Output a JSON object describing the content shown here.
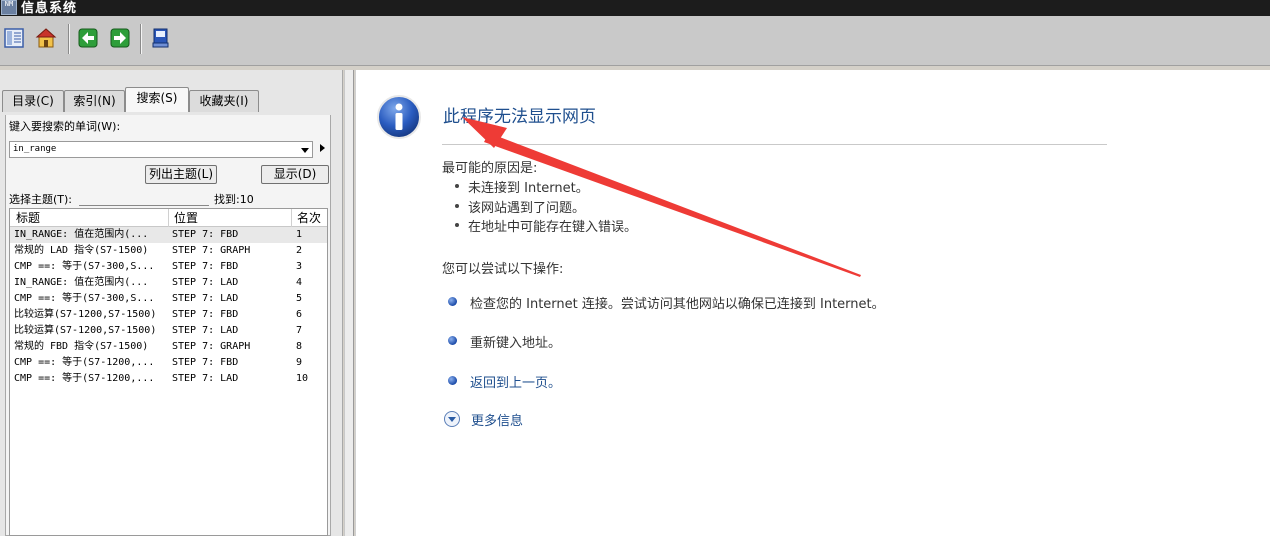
{
  "window": {
    "title": "信息系统",
    "app_icon_text": "NM"
  },
  "toolbar": {
    "buttons": [
      {
        "name": "hide-pane-button",
        "icon": "toc-pane-icon"
      },
      {
        "name": "home-button",
        "icon": "home-icon"
      },
      {
        "name": "back-button",
        "icon": "back-arrow-icon"
      },
      {
        "name": "forward-button",
        "icon": "forward-arrow-icon"
      },
      {
        "name": "print-button",
        "icon": "print-icon"
      }
    ],
    "colors": {
      "green": "#2e9e3a",
      "blue": "#2a56b8"
    }
  },
  "nav": {
    "tabs": [
      {
        "label": "目录(C)",
        "active": false
      },
      {
        "label": "索引(N)",
        "active": false
      },
      {
        "label": "搜索(S)",
        "active": true
      },
      {
        "label": "收藏夹(I)",
        "active": false
      }
    ]
  },
  "search": {
    "keyword_label": "键入要搜索的单词(W):",
    "keyword_value": "in_range",
    "list_topics_button": "列出主题(L)",
    "display_button": "显示(D)",
    "select_topic_label": "选择主题(T):",
    "found_label": "找到:10",
    "columns": [
      "标题",
      "位置",
      "名次"
    ],
    "rows": [
      {
        "title": "IN_RANGE: 值在范围内(...",
        "location": "STEP 7: FBD",
        "rank": "1"
      },
      {
        "title": "常规的 LAD 指令(S7-1500)",
        "location": "STEP 7: GRAPH",
        "rank": "2"
      },
      {
        "title": "CMP ==: 等于(S7-300,S...",
        "location": "STEP 7: FBD",
        "rank": "3"
      },
      {
        "title": "IN_RANGE: 值在范围内(...",
        "location": "STEP 7: LAD",
        "rank": "4"
      },
      {
        "title": "CMP ==: 等于(S7-300,S...",
        "location": "STEP 7: LAD",
        "rank": "5"
      },
      {
        "title": "比较运算(S7-1200,S7-1500)",
        "location": "STEP 7: FBD",
        "rank": "6"
      },
      {
        "title": "比较运算(S7-1200,S7-1500)",
        "location": "STEP 7: LAD",
        "rank": "7"
      },
      {
        "title": "常规的 FBD 指令(S7-1500)",
        "location": "STEP 7: GRAPH",
        "rank": "8"
      },
      {
        "title": "CMP ==: 等于(S7-1200,...",
        "location": "STEP 7: FBD",
        "rank": "9"
      },
      {
        "title": "CMP ==: 等于(S7-1200,...",
        "location": "STEP 7: LAD",
        "rank": "10"
      }
    ]
  },
  "error_page": {
    "title": "此程序无法显示网页",
    "causes_heading": "最可能的原因是:",
    "causes": [
      "未连接到 Internet。",
      "该网站遇到了问题。",
      "在地址中可能存在键入错误。"
    ],
    "try_heading": "您可以尝试以下操作:",
    "actions": [
      {
        "text": "检查您的 Internet 连接。尝试访问其他网站以确保已连接到 Internet。",
        "is_link": false
      },
      {
        "text": "重新键入地址。",
        "is_link": false
      },
      {
        "text": "返回到上一页。",
        "is_link": true
      }
    ],
    "more_info": "更多信息",
    "colors": {
      "title": "#1f4f8e",
      "text": "#333333"
    }
  },
  "annotation": {
    "arrow_color": "#ee3b36"
  }
}
